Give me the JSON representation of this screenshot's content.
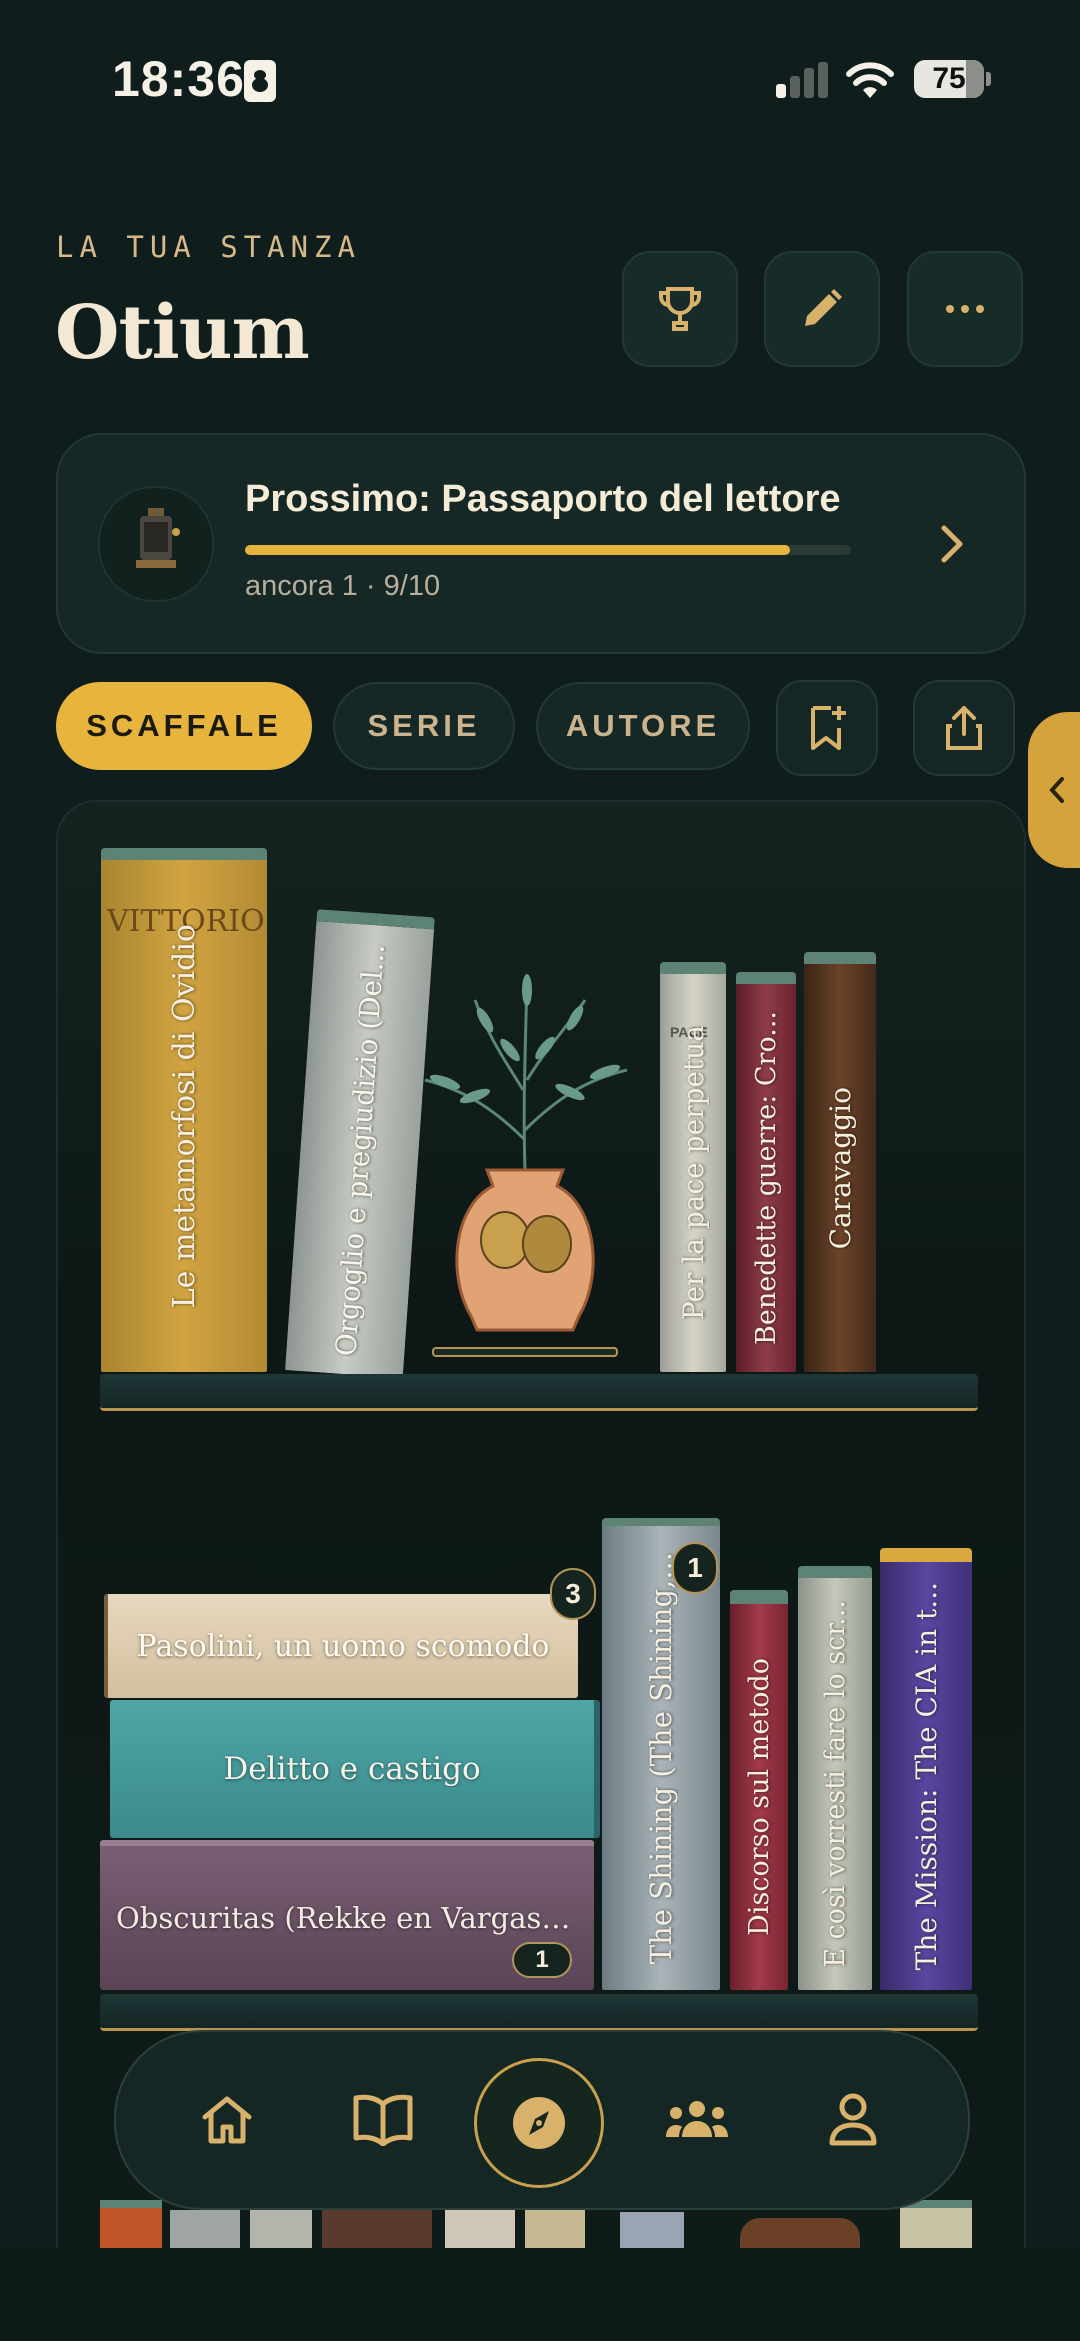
{
  "status": {
    "time": "18:36",
    "battery": "75"
  },
  "header": {
    "eyebrow": "LA TUA STANZA",
    "title": "Otium"
  },
  "progress_card": {
    "title": "Prossimo: Passaporto del lettore",
    "subtitle": "ancora 1 · 9/10",
    "progress": 0.9
  },
  "tabs": [
    {
      "label": "SCAFFALE",
      "active": true
    },
    {
      "label": "SERIE",
      "active": false
    },
    {
      "label": "AUTORE",
      "active": false
    }
  ],
  "shelf_1": {
    "books": [
      {
        "title": "Le metamorfosi di Ovidio",
        "cover_text": "VITTORIO"
      },
      {
        "title": "Orgoglio e pregiudizio (Del..."
      },
      {
        "title": "Per la pace perpetua",
        "cover_text": "PACE"
      },
      {
        "title": "Benedette guerre: Cro..."
      },
      {
        "title": "Caravaggio"
      }
    ]
  },
  "shelf_2": {
    "stacked": [
      {
        "title": "Pasolini, un uomo scomodo",
        "badge": "3"
      },
      {
        "title": "Delitto e castigo"
      },
      {
        "title": "Obscuritas (Rekke en Vargas,...",
        "badge": "1"
      }
    ],
    "standing": [
      {
        "title": "The Shining (The Shining,...",
        "badge": "1"
      },
      {
        "title": "Discorso sul metodo"
      },
      {
        "title": "E così vorresti fare lo scr..."
      },
      {
        "title": "The Mission: The CIA in t..."
      }
    ]
  },
  "nav": [
    "home-icon",
    "library-icon",
    "explore-compass-icon",
    "community-icon",
    "profile-icon"
  ],
  "colors": {
    "background": "#0f1e1c",
    "accent": "#e7b43e",
    "text": "#efe6d2"
  }
}
